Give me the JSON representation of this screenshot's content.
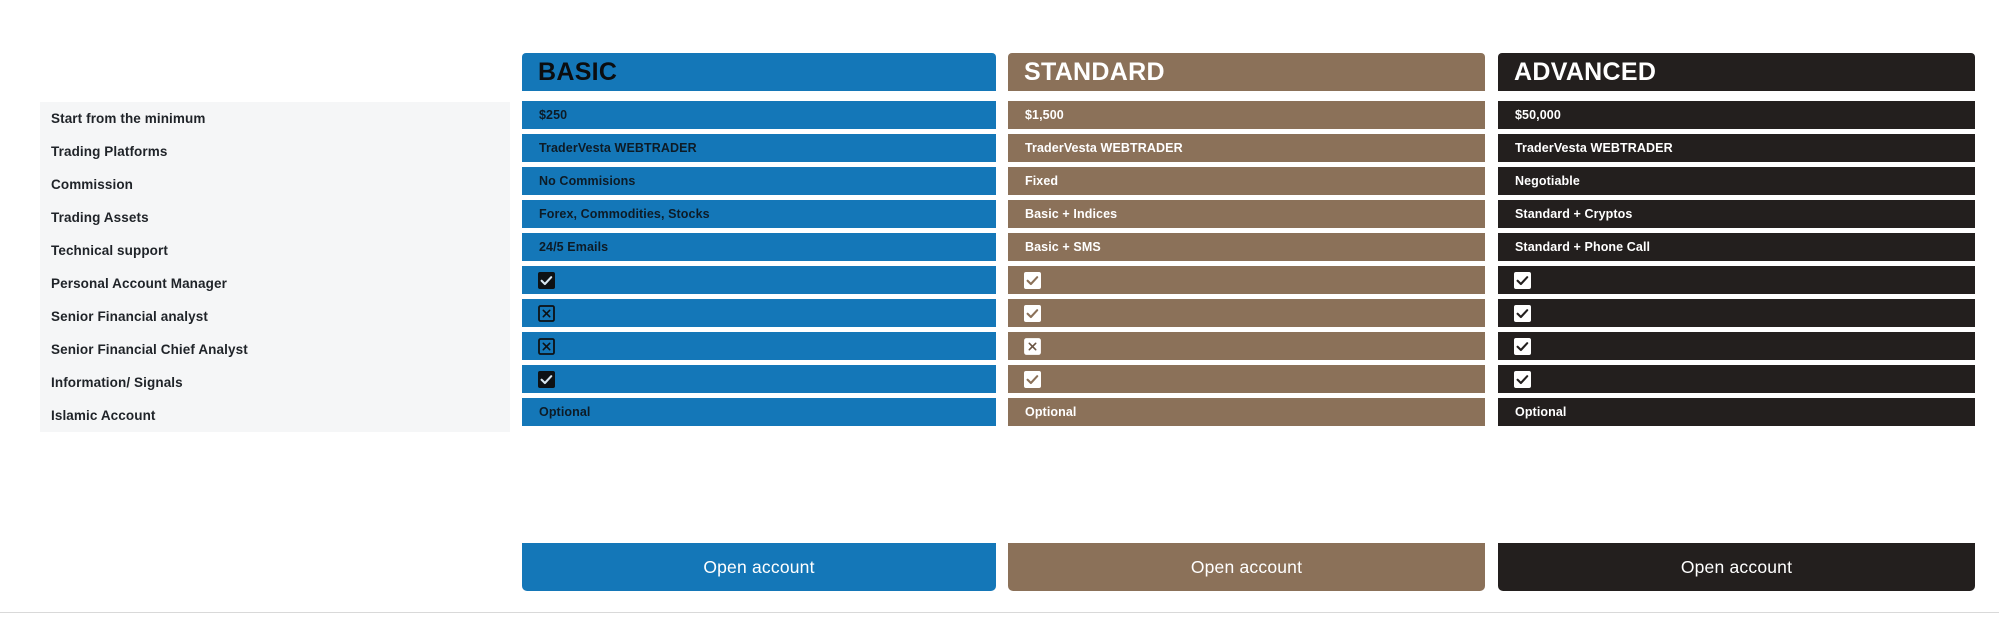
{
  "features": [
    "Start from the minimum",
    "Trading Platforms",
    "Commission",
    "Trading Assets",
    "Technical support",
    "Personal Account Manager",
    "Senior Financial analyst",
    "Senior Financial Chief Analyst",
    "Information/ Signals",
    "Islamic Account"
  ],
  "plans": [
    {
      "name": "BASIC",
      "color": "#1477b8",
      "cta": "Open account",
      "cells": [
        {
          "type": "text",
          "value": "$250"
        },
        {
          "type": "text",
          "value": "TraderVesta WEBTRADER"
        },
        {
          "type": "text",
          "value": "No Commisions"
        },
        {
          "type": "text",
          "value": "Forex, Commodities, Stocks"
        },
        {
          "type": "text",
          "value": "24/5 Emails"
        },
        {
          "type": "icon",
          "icon": "checkbox-checked-icon"
        },
        {
          "type": "icon",
          "icon": "checkbox-cross-icon"
        },
        {
          "type": "icon",
          "icon": "checkbox-cross-icon"
        },
        {
          "type": "icon",
          "icon": "checkbox-checked-icon"
        },
        {
          "type": "text",
          "value": "Optional"
        }
      ]
    },
    {
      "name": "STANDARD",
      "color": "#8b7159",
      "cta": "Open account",
      "cells": [
        {
          "type": "text",
          "value": "$1,500"
        },
        {
          "type": "text",
          "value": "TraderVesta WEBTRADER"
        },
        {
          "type": "text",
          "value": "Fixed"
        },
        {
          "type": "text",
          "value": "Basic + Indices"
        },
        {
          "type": "text",
          "value": "Basic + SMS"
        },
        {
          "type": "icon",
          "icon": "checkbox-checked-icon"
        },
        {
          "type": "icon",
          "icon": "checkbox-checked-icon"
        },
        {
          "type": "icon",
          "icon": "checkbox-cross-icon"
        },
        {
          "type": "icon",
          "icon": "checkbox-checked-icon"
        },
        {
          "type": "text",
          "value": "Optional"
        }
      ]
    },
    {
      "name": "ADVANCED",
      "color": "#231f1e",
      "cta": "Open account",
      "cells": [
        {
          "type": "text",
          "value": "$50,000"
        },
        {
          "type": "text",
          "value": "TraderVesta WEBTRADER"
        },
        {
          "type": "text",
          "value": "Negotiable"
        },
        {
          "type": "text",
          "value": "Standard + Cryptos"
        },
        {
          "type": "text",
          "value": "Standard + Phone Call"
        },
        {
          "type": "icon",
          "icon": "checkbox-checked-icon"
        },
        {
          "type": "icon",
          "icon": "checkbox-checked-icon"
        },
        {
          "type": "icon",
          "icon": "checkbox-checked-icon"
        },
        {
          "type": "icon",
          "icon": "checkbox-checked-icon"
        },
        {
          "type": "text",
          "value": "Optional"
        }
      ]
    }
  ]
}
